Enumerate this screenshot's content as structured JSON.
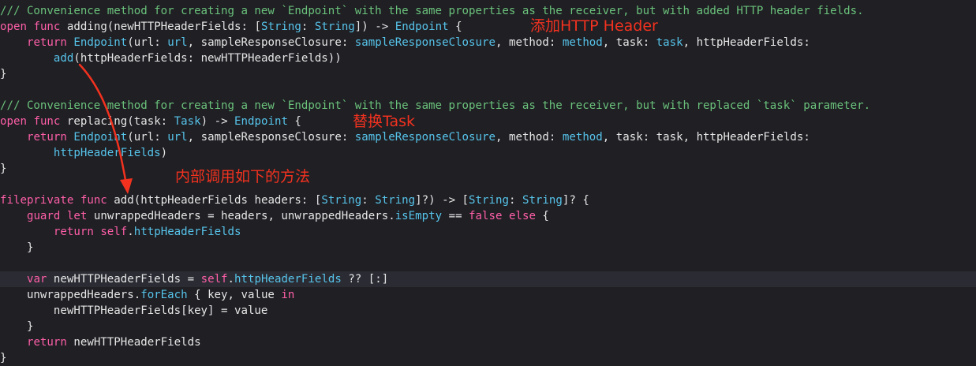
{
  "editor": {
    "lines": [
      {
        "tokens": [
          {
            "t": "/// Convenience method for creating a new `Endpoint` with the same properties as the receiver, but with added HTTP header fields.",
            "c": "comment"
          }
        ]
      },
      {
        "tokens": [
          {
            "t": "open",
            "c": "keyword"
          },
          {
            "t": " "
          },
          {
            "t": "func",
            "c": "keyword"
          },
          {
            "t": " adding(newHTTPHeaderFields: ["
          },
          {
            "t": "String",
            "c": "type"
          },
          {
            "t": ": "
          },
          {
            "t": "String",
            "c": "type"
          },
          {
            "t": "]) -> "
          },
          {
            "t": "Endpoint",
            "c": "type"
          },
          {
            "t": " {"
          }
        ]
      },
      {
        "tokens": [
          {
            "t": "    "
          },
          {
            "t": "return",
            "c": "keyword"
          },
          {
            "t": " "
          },
          {
            "t": "Endpoint",
            "c": "call"
          },
          {
            "t": "(url: "
          },
          {
            "t": "url",
            "c": "call"
          },
          {
            "t": ", sampleResponseClosure: "
          },
          {
            "t": "sampleResponseClosure",
            "c": "call"
          },
          {
            "t": ", method: "
          },
          {
            "t": "method",
            "c": "call"
          },
          {
            "t": ", task: "
          },
          {
            "t": "task",
            "c": "call"
          },
          {
            "t": ", httpHeaderFields:"
          }
        ]
      },
      {
        "tokens": [
          {
            "t": "        "
          },
          {
            "t": "add",
            "c": "call"
          },
          {
            "t": "(httpHeaderFields: newHTTPHeaderFields))"
          }
        ]
      },
      {
        "tokens": [
          {
            "t": "}"
          }
        ]
      },
      {
        "tokens": []
      },
      {
        "tokens": [
          {
            "t": "/// Convenience method for creating a new `Endpoint` with the same properties as the receiver, but with replaced `task` parameter.",
            "c": "comment"
          }
        ]
      },
      {
        "tokens": [
          {
            "t": "open",
            "c": "keyword"
          },
          {
            "t": " "
          },
          {
            "t": "func",
            "c": "keyword"
          },
          {
            "t": " replacing(task: "
          },
          {
            "t": "Task",
            "c": "type"
          },
          {
            "t": ") -> "
          },
          {
            "t": "Endpoint",
            "c": "type"
          },
          {
            "t": " {"
          }
        ]
      },
      {
        "tokens": [
          {
            "t": "    "
          },
          {
            "t": "return",
            "c": "keyword"
          },
          {
            "t": " "
          },
          {
            "t": "Endpoint",
            "c": "call"
          },
          {
            "t": "(url: "
          },
          {
            "t": "url",
            "c": "call"
          },
          {
            "t": ", sampleResponseClosure: "
          },
          {
            "t": "sampleResponseClosure",
            "c": "call"
          },
          {
            "t": ", method: "
          },
          {
            "t": "method",
            "c": "call"
          },
          {
            "t": ", task: task, httpHeaderFields:"
          }
        ]
      },
      {
        "tokens": [
          {
            "t": "        "
          },
          {
            "t": "httpHeaderFields",
            "c": "call"
          },
          {
            "t": ")"
          }
        ]
      },
      {
        "tokens": [
          {
            "t": "}"
          }
        ]
      },
      {
        "tokens": []
      },
      {
        "tokens": [
          {
            "t": "fileprivate",
            "c": "keyword"
          },
          {
            "t": " "
          },
          {
            "t": "func",
            "c": "keyword"
          },
          {
            "t": " add(httpHeaderFields headers: ["
          },
          {
            "t": "String",
            "c": "type"
          },
          {
            "t": ": "
          },
          {
            "t": "String",
            "c": "type"
          },
          {
            "t": "]?) -> ["
          },
          {
            "t": "String",
            "c": "type"
          },
          {
            "t": ": "
          },
          {
            "t": "String",
            "c": "type"
          },
          {
            "t": "]? {"
          }
        ]
      },
      {
        "tokens": [
          {
            "t": "    "
          },
          {
            "t": "guard",
            "c": "keyword"
          },
          {
            "t": " "
          },
          {
            "t": "let",
            "c": "keyword"
          },
          {
            "t": " unwrappedHeaders = headers, unwrappedHeaders."
          },
          {
            "t": "isEmpty",
            "c": "call"
          },
          {
            "t": " == "
          },
          {
            "t": "false",
            "c": "keyword"
          },
          {
            "t": " "
          },
          {
            "t": "else",
            "c": "keyword"
          },
          {
            "t": " {"
          }
        ]
      },
      {
        "tokens": [
          {
            "t": "        "
          },
          {
            "t": "return",
            "c": "keyword"
          },
          {
            "t": " "
          },
          {
            "t": "self",
            "c": "keyword"
          },
          {
            "t": "."
          },
          {
            "t": "httpHeaderFields",
            "c": "call"
          }
        ]
      },
      {
        "tokens": [
          {
            "t": "    }"
          }
        ]
      },
      {
        "tokens": []
      },
      {
        "tokens": [
          {
            "t": "    "
          },
          {
            "t": "var",
            "c": "keyword"
          },
          {
            "t": " newHTTPHeaderFields = "
          },
          {
            "t": "self",
            "c": "keyword"
          },
          {
            "t": "."
          },
          {
            "t": "httpHeaderFields",
            "c": "call"
          },
          {
            "t": " ?? [:]"
          }
        ],
        "highlighted": true
      },
      {
        "tokens": [
          {
            "t": "    unwrappedHeaders."
          },
          {
            "t": "forEach",
            "c": "call"
          },
          {
            "t": " { key, value "
          },
          {
            "t": "in",
            "c": "keyword"
          }
        ]
      },
      {
        "tokens": [
          {
            "t": "        newHTTPHeaderFields[key] = value"
          }
        ]
      },
      {
        "tokens": [
          {
            "t": "    }"
          }
        ]
      },
      {
        "tokens": [
          {
            "t": "    "
          },
          {
            "t": "return",
            "c": "keyword"
          },
          {
            "t": " newHTTPHeaderFields"
          }
        ]
      },
      {
        "tokens": [
          {
            "t": "}"
          }
        ]
      }
    ]
  },
  "annotations": {
    "add_header": "添加HTTP Header",
    "replace_task": "替换Task",
    "internal_call": "内部调用如下的方法"
  },
  "colors": {
    "background": "#1f1f24",
    "current_line": "#2a2b33",
    "comment": "#6bc27b",
    "keyword": "#ff5fa8",
    "type": "#57c4ea",
    "plain": "#e6e6e6",
    "annotation": "#f2321f"
  }
}
